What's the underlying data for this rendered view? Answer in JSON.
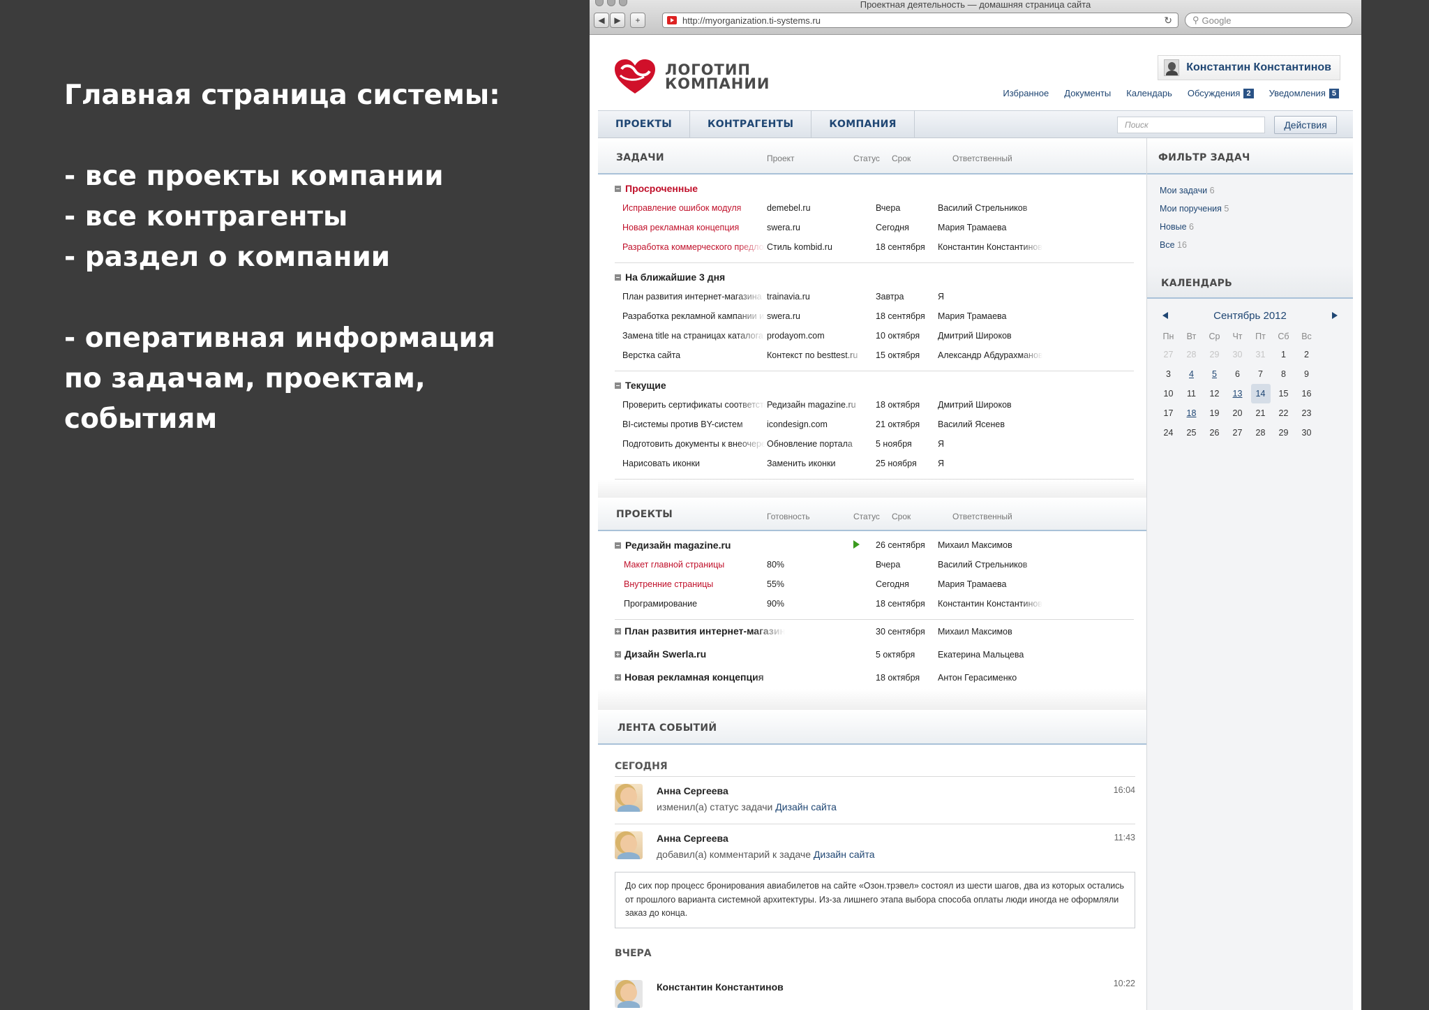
{
  "slide": {
    "heading": "Главная страница системы:",
    "bullets_a": [
      "- все проекты компании",
      "- все контрагенты",
      "- раздел о компании"
    ],
    "bullets_b": [
      "- оперативная информация",
      "по задачам, проектам,",
      "событиям"
    ]
  },
  "browser": {
    "window_title": "Проектная деятельность — домашняя страница сайта",
    "url": "http://myorganization.ti-systems.ru",
    "search_placeholder": "Google"
  },
  "header": {
    "logo_line1": "ЛОГОТИП",
    "logo_line2": "КОМПАНИИ",
    "user_name": "Константин Константинов",
    "links": [
      {
        "label": "Избранное",
        "badge": ""
      },
      {
        "label": "Документы",
        "badge": ""
      },
      {
        "label": "Календарь",
        "badge": ""
      },
      {
        "label": "Обсуждения",
        "badge": "2"
      },
      {
        "label": "Уведомления",
        "badge": "5"
      }
    ]
  },
  "nav": {
    "items": [
      "ПРОЕКТЫ",
      "КОНТРАГЕНТЫ",
      "КОМПАНИЯ"
    ],
    "search_placeholder": "Поиск",
    "actions_label": "Действия"
  },
  "tasks": {
    "title": "ЗАДАЧИ",
    "columns": [
      "Проект",
      "Статус",
      "Срок",
      "Ответственный"
    ],
    "groups": [
      {
        "title": "Просроченные",
        "overdue": true,
        "rows": [
          {
            "name": "Исправление ошибок модуля",
            "project": "demebel.ru",
            "status": "red",
            "due": "Вчера",
            "owner": "Василий Стрельников"
          },
          {
            "name": "Новая рекламная концепция",
            "project": "swera.ru",
            "status": "red",
            "due": "Сегодня",
            "owner": "Мария Трамаева"
          },
          {
            "name": "Разработка коммерческого предложения",
            "project": "Стиль kombid.ru",
            "status": "pause",
            "due": "18 сентября",
            "owner": "Константин Константинов"
          }
        ]
      },
      {
        "title": "На ближайшие 3 дня",
        "overdue": false,
        "rows": [
          {
            "name": "План развития интернет-магазина",
            "project": "trainavia.ru",
            "status": "stop",
            "due": "Завтра",
            "owner": "Я"
          },
          {
            "name": "Разработка рекламной кампании интернет",
            "project": "swera.ru",
            "status": "play",
            "due": "18 сентября",
            "owner": "Мария Трамаева"
          },
          {
            "name": "Замена title на страницах каталога",
            "project": "prodayom.com",
            "status": "play",
            "due": "10 октября",
            "owner": "Дмитрий Широков"
          },
          {
            "name": "Верстка сайта",
            "project": "Контекст по besttest.ru",
            "status": "play",
            "due": "15 октября",
            "owner": "Александр Абдурахманов"
          }
        ]
      },
      {
        "title": "Текущие",
        "overdue": false,
        "rows": [
          {
            "name": "Проверить сертификаты соответствия",
            "project": "Редизайн magazine.ru",
            "status": "play",
            "due": "18 октября",
            "owner": "Дмитрий Широков"
          },
          {
            "name": "BI-системы против BY-систем",
            "project": "icondesign.com",
            "status": "stop",
            "due": "21 октября",
            "owner": "Василий Ясенев"
          },
          {
            "name": "Подготовить документы к внеочередному",
            "project": "Обновление портала",
            "status": "stop",
            "due": "5 ноября",
            "owner": "Я"
          },
          {
            "name": "Нарисовать иконки",
            "project": "Заменить иконки",
            "status": "stop",
            "due": "25 ноября",
            "owner": "Я"
          }
        ]
      }
    ]
  },
  "projects": {
    "title": "ПРОЕКТЫ",
    "columns": [
      "Готовность",
      "Статус",
      "Срок",
      "Ответственный"
    ],
    "expanded": {
      "title": "Редизайн magazine.ru",
      "status": "play",
      "due": "26 сентября",
      "owner": "Михаил Максимов",
      "rows": [
        {
          "name": "Макет главной страницы",
          "ready": "80%",
          "status": "red",
          "due": "Вчера",
          "owner": "Василий Стрельников",
          "overdue": true
        },
        {
          "name": "Внутренние страницы",
          "ready": "55%",
          "status": "red",
          "due": "Сегодня",
          "owner": "Мария Трамаева",
          "overdue": true
        },
        {
          "name": "Програмирование",
          "ready": "90%",
          "status": "play",
          "due": "18 сентября",
          "owner": "Константин Константинов",
          "overdue": false
        }
      ]
    },
    "collapsed": [
      {
        "title": "План развития интернет-магазина",
        "status": "play",
        "due": "30 сентября",
        "owner": "Михаил Максимов"
      },
      {
        "title": "Дизайн Swerla.ru",
        "status": "pause",
        "due": "5 октября",
        "owner": "Екатерина Мальцева"
      },
      {
        "title": "Новая рекламная концепция",
        "status": "pause",
        "due": "18 октября",
        "owner": "Антон Герасименко"
      }
    ]
  },
  "events": {
    "title": "ЛЕНТА СОБЫТИЙ",
    "today_label": "СЕГОДНЯ",
    "yesterday_label": "ВЧЕРА",
    "items": [
      {
        "name": "Анна Сергеева",
        "action": "изменил(а) статус задачи",
        "target": "Дизайн сайта",
        "time": "16:04"
      },
      {
        "name": "Анна Сергеева",
        "action": "добавил(а) комментарий к задаче",
        "target": "Дизайн сайта",
        "time": "11:43"
      }
    ],
    "comment": "До сих пор процесс бронирования авиабилетов на сайте «Озон.трэвел» состоял из шести шагов, два из которых остались от прошлого варианта системной архитектуры. Из-за лишнего этапа выбора способа оплаты люди иногда не оформляли заказ до конца.",
    "yesterday_item": {
      "name": "Константин Константинов",
      "time": "10:22"
    }
  },
  "filter": {
    "title": "ФИЛЬТР ЗАДАЧ",
    "items": [
      {
        "label": "Мои задачи",
        "count": "6"
      },
      {
        "label": "Мои поручения",
        "count": "5"
      },
      {
        "label": "Новые",
        "count": "6"
      },
      {
        "label": "Все",
        "count": "16"
      }
    ]
  },
  "calendar": {
    "title": "КАЛЕНДАРЬ",
    "month": "Сентябрь",
    "year": "2012",
    "weekdays": [
      "Пн",
      "Вт",
      "Ср",
      "Чт",
      "Пт",
      "Сб",
      "Вс"
    ],
    "days": [
      {
        "d": "27",
        "o": 1
      },
      {
        "d": "28",
        "o": 1
      },
      {
        "d": "29",
        "o": 1
      },
      {
        "d": "30",
        "o": 1
      },
      {
        "d": "31",
        "o": 1
      },
      {
        "d": "1"
      },
      {
        "d": "2"
      },
      {
        "d": "3"
      },
      {
        "d": "4",
        "e": 1
      },
      {
        "d": "5",
        "e": 1
      },
      {
        "d": "6"
      },
      {
        "d": "7"
      },
      {
        "d": "8"
      },
      {
        "d": "9"
      },
      {
        "d": "10"
      },
      {
        "d": "11"
      },
      {
        "d": "12"
      },
      {
        "d": "13",
        "e": 1
      },
      {
        "d": "14",
        "t": 1
      },
      {
        "d": "15"
      },
      {
        "d": "16"
      },
      {
        "d": "17"
      },
      {
        "d": "18",
        "e": 1
      },
      {
        "d": "19"
      },
      {
        "d": "20"
      },
      {
        "d": "21"
      },
      {
        "d": "22"
      },
      {
        "d": "23"
      },
      {
        "d": "24"
      },
      {
        "d": "25"
      },
      {
        "d": "26"
      },
      {
        "d": "27"
      },
      {
        "d": "28"
      },
      {
        "d": "29"
      },
      {
        "d": "30"
      }
    ]
  },
  "colors": {
    "accent": "#1f4673",
    "overdue": "#c0102a",
    "play": "#3a9a1e",
    "brand": "#d0102a"
  }
}
